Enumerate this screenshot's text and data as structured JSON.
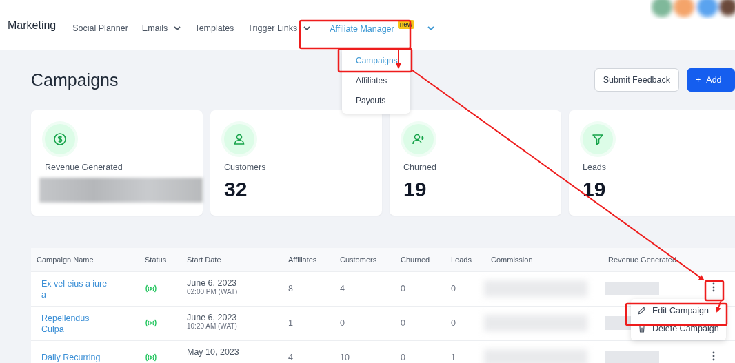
{
  "app": {
    "title": "Marketing"
  },
  "nav": [
    {
      "label": "Social Planner",
      "dropdown": false,
      "selected": false
    },
    {
      "label": "Emails",
      "dropdown": true,
      "selected": false
    },
    {
      "label": "Templates",
      "dropdown": false,
      "selected": false
    },
    {
      "label": "Trigger Links",
      "dropdown": true,
      "selected": false
    },
    {
      "label": "Affiliate Manager",
      "badge": "new",
      "dropdown": true,
      "selected": true
    }
  ],
  "nav_menu": [
    {
      "label": "Campaigns",
      "selected": true
    },
    {
      "label": "Affiliates",
      "selected": false
    },
    {
      "label": "Payouts",
      "selected": false
    }
  ],
  "page": {
    "title": "Campaigns",
    "buttons": [
      {
        "label": "Submit Feedback",
        "kind": "secondary"
      },
      {
        "label": "Add",
        "kind": "primary",
        "icon": "+"
      }
    ]
  },
  "stats": [
    {
      "label": "Revenue Generated",
      "redacted": true
    },
    {
      "label": "Customers",
      "value": "32",
      "redacted": false
    },
    {
      "label": "Churned",
      "value": "19",
      "redacted": false
    },
    {
      "label": "Leads",
      "value": "19",
      "redacted": false
    }
  ],
  "table": {
    "columns": [
      "Campaign Name",
      "Status",
      "Start Date",
      "Affiliates",
      "Customers",
      "Churned",
      "Leads",
      "Commission",
      "Revenue Generated"
    ],
    "rows": [
      {
        "name": "Ex vel eius a iure a",
        "date": "June 6, 2023",
        "time": "02:00 PM (WAT)",
        "affiliates": "8",
        "customers": "4",
        "churned": "0",
        "leads": "0",
        "menu": [
          {
            "label": "Edit Campaign",
            "kind": "edit"
          },
          {
            "label": "Delete Campaign",
            "kind": "delete"
          }
        ]
      },
      {
        "name": "Repellendus Culpa",
        "date": "June 6, 2023",
        "time": "10:20 AM (WAT)",
        "affiliates": "1",
        "customers": "0",
        "churned": "0",
        "leads": "0"
      },
      {
        "name": "Daily Recurring",
        "date": "May 10, 2023",
        "affiliates": "4",
        "customers": "10",
        "churned": "0",
        "leads": "1"
      }
    ]
  }
}
